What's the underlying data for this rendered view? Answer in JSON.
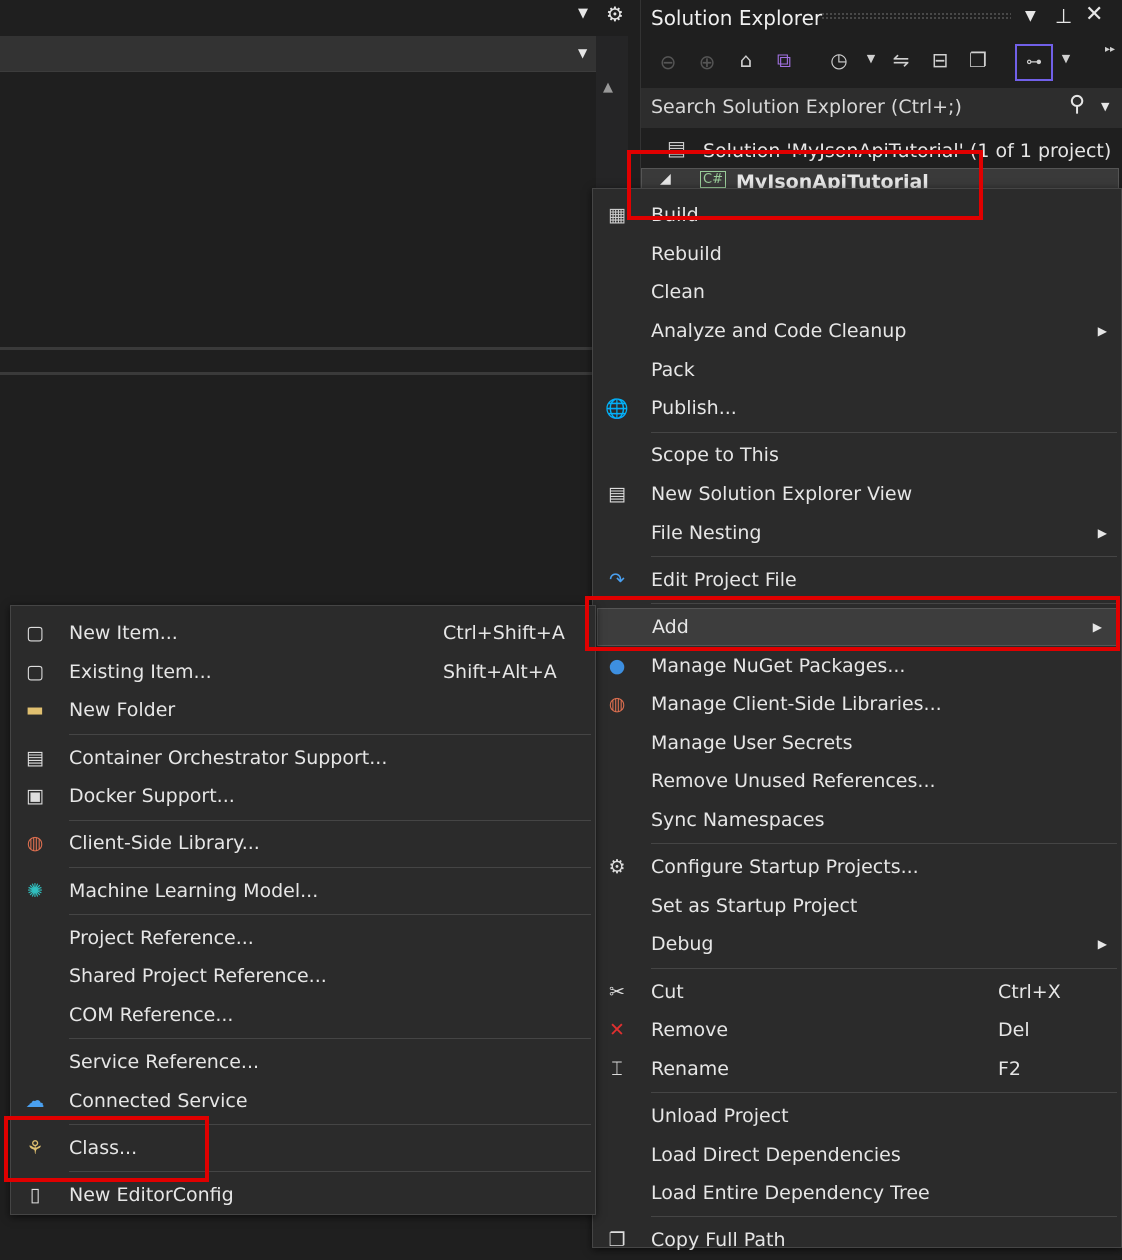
{
  "solution_explorer": {
    "title": "Solution Explorer",
    "search_placeholder": "Search Solution Explorer (Ctrl+;)",
    "solution_label": "Solution 'MyJsonApiTutorial' (1 of 1 project)",
    "project_label": "MyJsonApiTutorial",
    "toolbar_icons": [
      "back-icon",
      "forward-icon",
      "home-icon",
      "vs-switch-views-icon",
      "pending-changes-filter-icon",
      "sync-icon",
      "collapse-all-icon",
      "show-all-files-icon",
      "properties-view-icon"
    ]
  },
  "context_menu": [
    {
      "label": "Build",
      "icon": "build-icon"
    },
    {
      "label": "Rebuild"
    },
    {
      "label": "Clean"
    },
    {
      "label": "Analyze and Code Cleanup",
      "submenu": true
    },
    {
      "label": "Pack"
    },
    {
      "label": "Publish...",
      "icon": "globe-publish-icon"
    },
    {
      "sep": true
    },
    {
      "label": "Scope to This"
    },
    {
      "label": "New Solution Explorer View",
      "icon": "new-view-icon"
    },
    {
      "label": "File Nesting",
      "submenu": true
    },
    {
      "sep": true
    },
    {
      "label": "Edit Project File",
      "icon": "edit-redo-icon"
    },
    {
      "sep": true
    },
    {
      "label": "Add",
      "submenu": true,
      "highlighted": true
    },
    {
      "label": "Manage NuGet Packages...",
      "icon": "nuget-icon"
    },
    {
      "label": "Manage Client-Side Libraries...",
      "icon": "client-library-icon"
    },
    {
      "label": "Manage User Secrets"
    },
    {
      "label": "Remove Unused References..."
    },
    {
      "label": "Sync Namespaces"
    },
    {
      "sep": true
    },
    {
      "label": "Configure Startup Projects...",
      "icon": "gear-icon"
    },
    {
      "label": "Set as Startup Project"
    },
    {
      "label": "Debug",
      "submenu": true
    },
    {
      "sep": true
    },
    {
      "label": "Cut",
      "shortcut": "Ctrl+X",
      "icon": "scissors-icon"
    },
    {
      "label": "Remove",
      "shortcut": "Del",
      "icon": "close-red-icon"
    },
    {
      "label": "Rename",
      "shortcut": "F2",
      "icon": "rename-icon"
    },
    {
      "sep": true
    },
    {
      "label": "Unload Project"
    },
    {
      "label": "Load Direct Dependencies"
    },
    {
      "label": "Load Entire Dependency Tree"
    },
    {
      "sep": true
    },
    {
      "label": "Copy Full Path",
      "icon": "copy-icon"
    }
  ],
  "add_submenu": [
    {
      "label": "New Item...",
      "shortcut": "Ctrl+Shift+A",
      "icon": "new-item-icon"
    },
    {
      "label": "Existing Item...",
      "shortcut": "Shift+Alt+A",
      "icon": "existing-item-icon"
    },
    {
      "label": "New Folder",
      "icon": "new-folder-icon"
    },
    {
      "sep": true
    },
    {
      "label": "Container Orchestrator Support...",
      "icon": "container-icon"
    },
    {
      "label": "Docker Support...",
      "icon": "docker-icon"
    },
    {
      "sep": true
    },
    {
      "label": "Client-Side Library...",
      "icon": "client-library-icon"
    },
    {
      "sep": true
    },
    {
      "label": "Machine Learning Model...",
      "icon": "ml-model-icon"
    },
    {
      "sep": true
    },
    {
      "label": "Project Reference..."
    },
    {
      "label": "Shared Project Reference..."
    },
    {
      "label": "COM Reference..."
    },
    {
      "sep": true
    },
    {
      "label": "Service Reference..."
    },
    {
      "label": "Connected Service",
      "icon": "connected-service-icon"
    },
    {
      "sep": true
    },
    {
      "label": "Class...",
      "icon": "class-icon"
    },
    {
      "sep": true
    },
    {
      "label": "New EditorConfig",
      "icon": "file-icon"
    }
  ],
  "colors": {
    "highlight_box": "#e00000",
    "menu_bg": "#2b2b2b",
    "accent": "#7160e8"
  }
}
